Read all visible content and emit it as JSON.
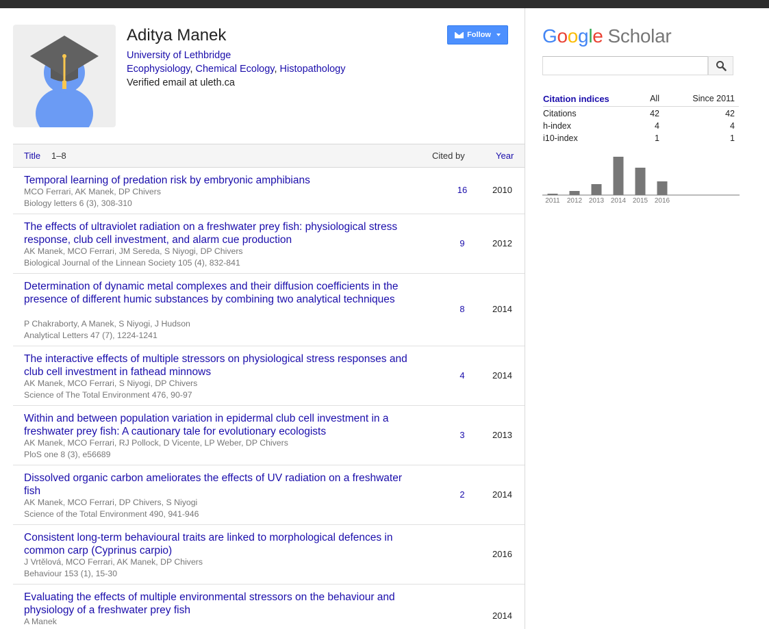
{
  "profile": {
    "name": "Aditya Manek",
    "affiliation": "University of Lethbridge",
    "interests": [
      "Ecophysiology",
      "Chemical Ecology",
      "Histopathology"
    ],
    "verified_email": "Verified email at uleth.ca",
    "follow_label": "Follow"
  },
  "table": {
    "title_label": "Title",
    "range_label": "1–8",
    "cited_label": "Cited by",
    "year_label": "Year"
  },
  "articles": [
    {
      "title": "Temporal learning of predation risk by embryonic amphibians",
      "authors": "MCO Ferrari, AK Manek, DP Chivers",
      "venue": "Biology letters 6 (3), 308-310",
      "cited": "16",
      "year": "2010"
    },
    {
      "title": "The effects of ultraviolet radiation on a freshwater prey fish: physiological stress response, club cell investment, and alarm cue production",
      "authors": "AK Manek, MCO Ferrari, JM Sereda, S Niyogi, DP Chivers",
      "venue": "Biological Journal of the Linnean Society 105 (4), 832-841",
      "cited": "9",
      "year": "2012"
    },
    {
      "title": "Determination of dynamic metal complexes and their diffusion coefficients in the presence of different humic substances by combining two analytical techniques",
      "authors": "P Chakraborty, A Manek, S Niyogi, J Hudson",
      "venue": "Analytical Letters 47 (7), 1224-1241",
      "cited": "8",
      "year": "2014"
    },
    {
      "title": "The interactive effects of multiple stressors on physiological stress responses and club cell investment in fathead minnows",
      "authors": "AK Manek, MCO Ferrari, S Niyogi, DP Chivers",
      "venue": "Science of The Total Environment 476, 90-97",
      "cited": "4",
      "year": "2014"
    },
    {
      "title": "Within and between population variation in epidermal club cell investment in a freshwater prey fish: A cautionary tale for evolutionary ecologists",
      "authors": "AK Manek, MCO Ferrari, RJ Pollock, D Vicente, LP Weber, DP Chivers",
      "venue": "PloS one 8 (3), e56689",
      "cited": "3",
      "year": "2013"
    },
    {
      "title": "Dissolved organic carbon ameliorates the effects of UV radiation on a freshwater fish",
      "authors": "AK Manek, MCO Ferrari, DP Chivers, S Niyogi",
      "venue": "Science of the Total Environment 490, 941-946",
      "cited": "2",
      "year": "2014"
    },
    {
      "title": "Consistent long-term behavioural traits are linked to morphological defences in common carp (Cyprinus carpio)",
      "authors": "J Vrtělová, MCO Ferrari, AK Manek, DP Chivers",
      "venue": "Behaviour 153 (1), 15-30",
      "cited": "",
      "year": "2016"
    },
    {
      "title": "Evaluating the effects of multiple environmental stressors on the behaviour and physiology of a freshwater prey fish",
      "authors": "A Manek",
      "venue": "",
      "cited": "",
      "year": "2014"
    }
  ],
  "sidebar": {
    "logo_google": [
      "G",
      "o",
      "o",
      "g",
      "l",
      "e"
    ],
    "logo_scholar": "Scholar",
    "search_placeholder": "",
    "citation_indices": {
      "heading": "Citation indices",
      "col_all": "All",
      "col_since": "Since 2011",
      "rows": [
        {
          "label": "Citations",
          "all": "42",
          "since": "42"
        },
        {
          "label": "h-index",
          "all": "4",
          "since": "4"
        },
        {
          "label": "i10-index",
          "all": "1",
          "since": "1"
        }
      ]
    },
    "colors": {
      "logo_blue": "#4285f4",
      "logo_red": "#ea4335",
      "logo_yellow": "#fbbc05",
      "logo_green": "#34a853",
      "bar": "#777777"
    }
  },
  "chart_data": {
    "type": "bar",
    "categories": [
      "2011",
      "2012",
      "2013",
      "2014",
      "2015",
      "2016"
    ],
    "values": [
      1,
      3,
      8,
      28,
      20,
      10
    ],
    "ylim": [
      0,
      28
    ],
    "grid": false
  }
}
